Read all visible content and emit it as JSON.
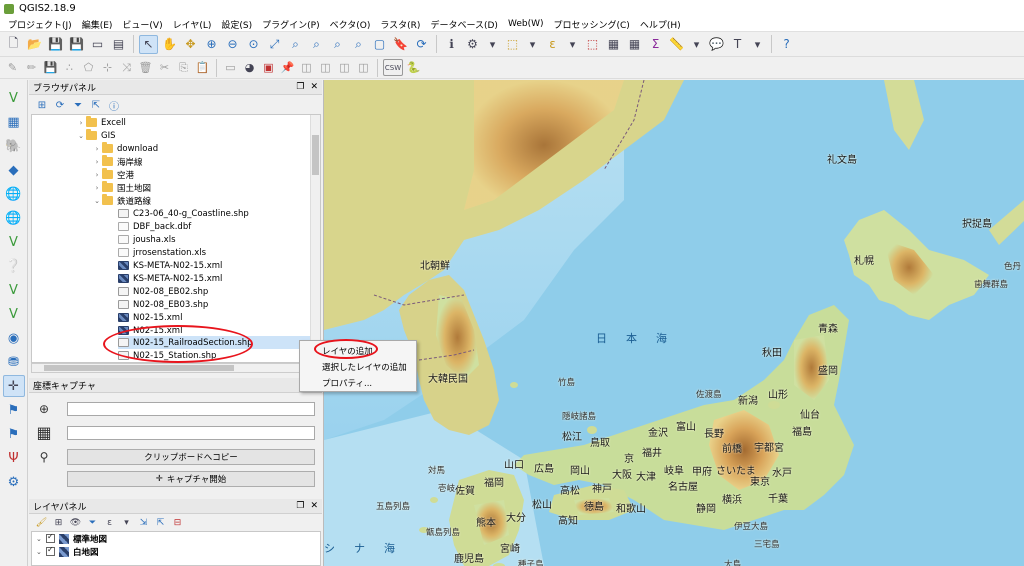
{
  "window": {
    "title": "QGIS2.18.9"
  },
  "menu": [
    "プロジェクト(J)",
    "編集(E)",
    "ビュー(V)",
    "レイヤ(L)",
    "設定(S)",
    "プラグイン(P)",
    "ベクタ(O)",
    "ラスタ(R)",
    "データベース(D)",
    "Web(W)",
    "プロセッシング(C)",
    "ヘルプ(H)"
  ],
  "toolbar": {
    "csw_label": "CSW",
    "sigma": "Σ",
    "text_tool": "T"
  },
  "browser_panel": {
    "title": "ブラウザパネル",
    "tree": [
      {
        "label": "Excell",
        "type": "folder",
        "level": 3,
        "expanded": false
      },
      {
        "label": "GIS",
        "type": "folder",
        "level": 3,
        "expanded": true
      },
      {
        "label": "download",
        "type": "folder",
        "level": 4,
        "expanded": false
      },
      {
        "label": "海岸線",
        "type": "folder",
        "level": 4,
        "expanded": false
      },
      {
        "label": "空港",
        "type": "folder",
        "level": 4,
        "expanded": false
      },
      {
        "label": "国土地図",
        "type": "folder",
        "level": 4,
        "expanded": false
      },
      {
        "label": "鉄道路線",
        "type": "folder",
        "level": 4,
        "expanded": true
      },
      {
        "label": "C23-06_40-g_Coastline.shp",
        "type": "shp",
        "level": 5
      },
      {
        "label": "DBF_back.dbf",
        "type": "file",
        "level": 5
      },
      {
        "label": "jousha.xls",
        "type": "file",
        "level": 5
      },
      {
        "label": "jrrosenstation.xls",
        "type": "file",
        "level": 5
      },
      {
        "label": "KS-META-N02-15.xml",
        "type": "xml",
        "level": 5
      },
      {
        "label": "KS-META-N02-15.xml",
        "type": "xml",
        "level": 5
      },
      {
        "label": "N02-08_EB02.shp",
        "type": "shp",
        "level": 5
      },
      {
        "label": "N02-08_EB03.shp",
        "type": "shp",
        "level": 5
      },
      {
        "label": "N02-15.xml",
        "type": "xml",
        "level": 5
      },
      {
        "label": "N02-15.xml",
        "type": "xml",
        "level": 5
      },
      {
        "label": "N02-15_RailroadSection.shp",
        "type": "shp",
        "level": 5,
        "selected": true
      },
      {
        "label": "N02-15_Station.shp",
        "type": "shp",
        "level": 5
      }
    ]
  },
  "context_menu": {
    "items": [
      "レイヤの追加",
      "選択したレイヤの追加",
      "プロパティ..."
    ]
  },
  "coord_panel": {
    "title": "座標キャプチャ",
    "copy_button": "クリップボードへコピー",
    "capture_button": "キャプチャ開始"
  },
  "layer_panel": {
    "title": "レイヤパネル",
    "layers": [
      {
        "name": "標準地図",
        "checked": true
      },
      {
        "name": "白地図",
        "checked": true
      }
    ]
  },
  "map": {
    "sea_label_1": "日　本　海",
    "sea_label_2": "シ　ナ　海",
    "places": [
      {
        "name": "礼文島",
        "small": false
      },
      {
        "name": "択捉島",
        "small": false
      },
      {
        "name": "札幌",
        "small": false
      },
      {
        "name": "色丹",
        "small": true
      },
      {
        "name": "歯舞群島",
        "small": true
      },
      {
        "name": "北朝鮮",
        "small": false
      },
      {
        "name": "大韓民国",
        "small": false
      },
      {
        "name": "青森",
        "small": false
      },
      {
        "name": "秋田",
        "small": false
      },
      {
        "name": "盛岡",
        "small": false
      },
      {
        "name": "山形",
        "small": false
      },
      {
        "name": "仙台",
        "small": false
      },
      {
        "name": "新潟",
        "small": false
      },
      {
        "name": "福島",
        "small": false
      },
      {
        "name": "佐渡島",
        "small": true
      },
      {
        "name": "竹島",
        "small": true
      },
      {
        "name": "隠岐諸島",
        "small": true
      },
      {
        "name": "金沢",
        "small": false
      },
      {
        "name": "富山",
        "small": false
      },
      {
        "name": "長野",
        "small": false
      },
      {
        "name": "前橋",
        "small": false
      },
      {
        "name": "宇都宮",
        "small": false
      },
      {
        "name": "水戸",
        "small": false
      },
      {
        "name": "松江",
        "small": false
      },
      {
        "name": "鳥取",
        "small": false
      },
      {
        "name": "福井",
        "small": false
      },
      {
        "name": "京",
        "small": false
      },
      {
        "name": "岐阜",
        "small": false
      },
      {
        "name": "甲府",
        "small": false
      },
      {
        "name": "さいたま",
        "small": false
      },
      {
        "name": "東京",
        "small": false
      },
      {
        "name": "千葉",
        "small": false
      },
      {
        "name": "山口",
        "small": false
      },
      {
        "name": "広島",
        "small": false
      },
      {
        "name": "岡山",
        "small": false
      },
      {
        "name": "大阪",
        "small": false
      },
      {
        "name": "神戸",
        "small": false
      },
      {
        "name": "大津",
        "small": false
      },
      {
        "name": "名古屋",
        "small": false
      },
      {
        "name": "静岡",
        "small": false
      },
      {
        "name": "横浜",
        "small": false
      },
      {
        "name": "福岡",
        "small": false
      },
      {
        "name": "佐賀",
        "small": false
      },
      {
        "name": "高松",
        "small": false
      },
      {
        "name": "徳島",
        "small": false
      },
      {
        "name": "和歌山",
        "small": false
      },
      {
        "name": "松山",
        "small": false
      },
      {
        "name": "高知",
        "small": false
      },
      {
        "name": "大分",
        "small": false
      },
      {
        "name": "熊本",
        "small": false
      },
      {
        "name": "宮崎",
        "small": false
      },
      {
        "name": "鹿児島",
        "small": false
      },
      {
        "name": "対馬",
        "small": true
      },
      {
        "name": "壱岐",
        "small": true
      },
      {
        "name": "五島列島",
        "small": true
      },
      {
        "name": "甑島列島",
        "small": true
      },
      {
        "name": "伊豆大島",
        "small": true
      },
      {
        "name": "三宅島",
        "small": true
      },
      {
        "name": "大島",
        "small": true
      },
      {
        "name": "種子島",
        "small": true
      }
    ]
  }
}
